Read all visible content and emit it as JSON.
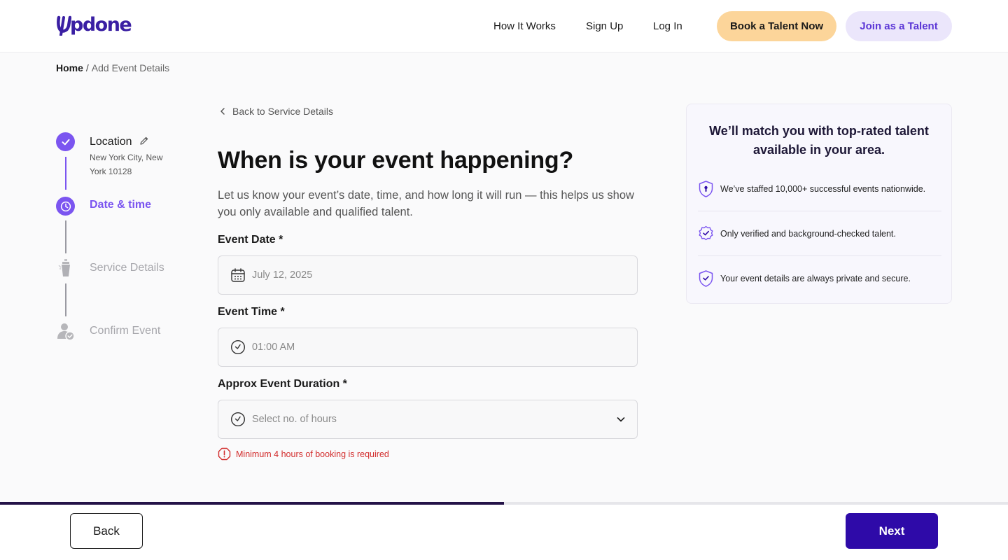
{
  "header": {
    "logo_text": "pdone",
    "nav": [
      "How It Works",
      "Sign Up",
      "Log In"
    ],
    "book_button": "Book a Talent Now",
    "join_button": "Join as a Talent"
  },
  "breadcrumb": {
    "home": "Home",
    "separator": "/",
    "current": "Add Event Details"
  },
  "stepper": {
    "steps": [
      {
        "title": "Location",
        "subtitle": "New York City, New York 10128",
        "state": "completed",
        "icon": "check-icon"
      },
      {
        "title": "Date & time",
        "state": "active",
        "icon": "clock-icon"
      },
      {
        "title": "Service Details",
        "state": "pending",
        "icon": "cocktail-shaker-icon"
      },
      {
        "title": "Confirm Event",
        "state": "pending",
        "icon": "user-check-icon"
      }
    ]
  },
  "form": {
    "back_link": "Back to Service Details",
    "title": "When is your event happening?",
    "description": "Let us know your event’s date, time, and how long it will run — this helps us show you only available and qualified talent.",
    "event_date": {
      "label": "Event Date *",
      "placeholder": "July 12, 2025",
      "icon": "calendar-icon"
    },
    "event_time": {
      "label": "Event Time *",
      "placeholder": "01:00 AM",
      "icon": "clock-icon"
    },
    "duration": {
      "label": "Approx Event Duration *",
      "placeholder": "Select no. of hours",
      "icon": "clock-icon"
    },
    "error": "Minimum 4 hours of booking is required"
  },
  "info_card": {
    "title": "We’ll match you with top-rated talent available in your area.",
    "items": [
      {
        "text": "We’ve staffed 10,000+ successful events nationwide.",
        "icon": "shield-icon"
      },
      {
        "text": "Only verified and background-checked talent.",
        "icon": "verified-badge-icon"
      },
      {
        "text": "Your event details are always private and secure.",
        "icon": "shield-check-icon"
      }
    ]
  },
  "footer": {
    "progress": 0.5,
    "back_button": "Back",
    "next_button": "Next"
  },
  "colors": {
    "brand": "#3a1fa3",
    "accent": "#7b55f0",
    "primary_button": "#2e0aa8",
    "book_button": "#fcd59a",
    "error": "#d22c2c"
  }
}
